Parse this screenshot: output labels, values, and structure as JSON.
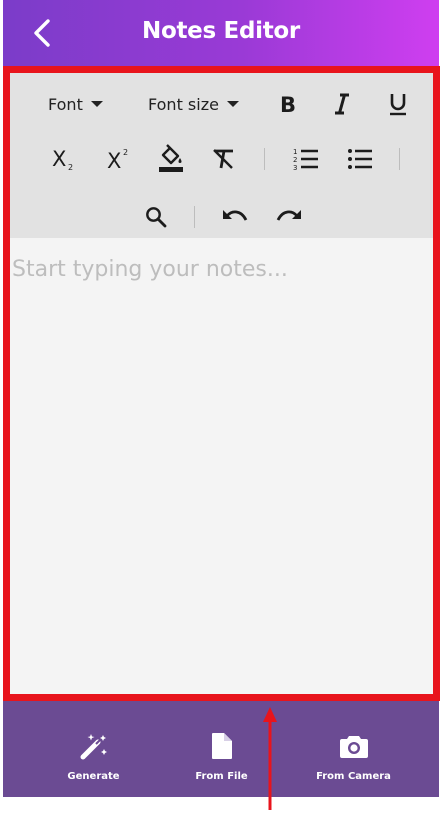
{
  "header": {
    "title": "Notes Editor",
    "back_icon": "chevron-left-icon",
    "gradient": [
      "#7b3cc9",
      "#cf3ef0"
    ]
  },
  "toolbar": {
    "font_label": "Font",
    "font_size_label": "Font size",
    "icons": [
      "bold-icon",
      "italic-icon",
      "underline-icon",
      "subscript-icon",
      "superscript-icon",
      "fill-color-icon",
      "clear-format-icon",
      "numbered-list-icon",
      "bullet-list-icon",
      "search-icon",
      "undo-icon",
      "redo-icon"
    ]
  },
  "editor": {
    "placeholder": "Start typing your notes...",
    "highlight_color": "#e8141c"
  },
  "bottom_bar": {
    "color": "#6b4b93",
    "actions": [
      {
        "label": "Generate",
        "icon": "magic-wand-icon"
      },
      {
        "label": "From File",
        "icon": "file-icon"
      },
      {
        "label": "From Camera",
        "icon": "camera-icon"
      }
    ]
  }
}
